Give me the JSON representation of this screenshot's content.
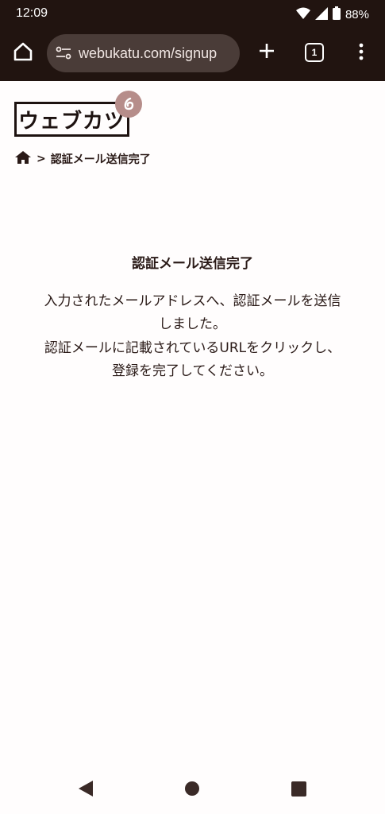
{
  "status": {
    "time": "12:09",
    "battery": "88%",
    "icons": [
      "wifi-icon",
      "signal-icon",
      "battery-icon"
    ]
  },
  "browser": {
    "url": "webukatu.com/signup",
    "tab_count": "1",
    "icons": [
      "home-icon",
      "site-settings-icon",
      "plus-icon",
      "tabs-icon",
      "more-vert-icon"
    ]
  },
  "site": {
    "logo_text": "ウェブカツ",
    "breadcrumb": {
      "separator": ">",
      "current": "認証メール送信完了"
    }
  },
  "main": {
    "title": "認証メール送信完了",
    "lines": [
      "入力されたメールアドレスへ、認証メールを送信",
      "しました。",
      "認証メールに記載されているURLをクリックし、",
      "登録を完了してください。"
    ]
  },
  "colors": {
    "bar": "#211410",
    "urlbar": "#4a3c38",
    "badge": "#b68d8a",
    "text": "#2a1a17",
    "nav": "#3a2a27"
  }
}
